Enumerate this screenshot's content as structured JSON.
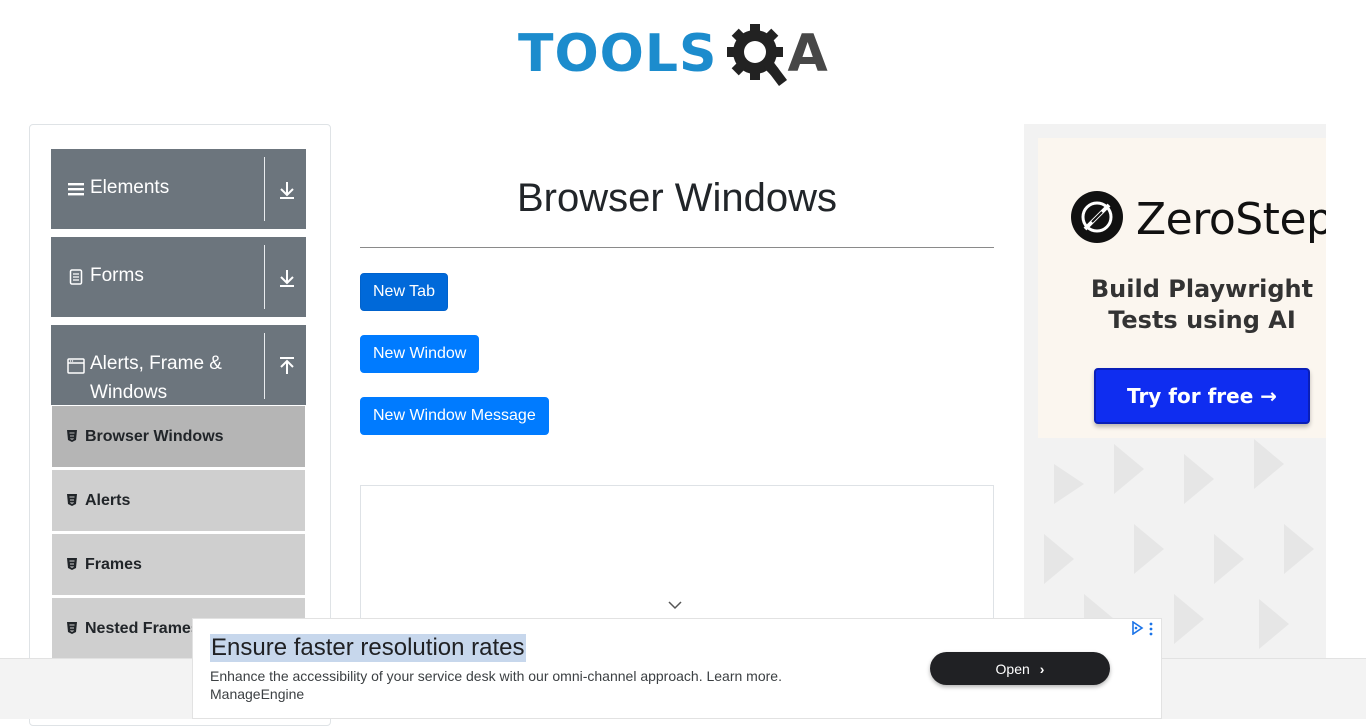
{
  "header": {
    "logo_text": "TOOLS",
    "logo_suffix": "A"
  },
  "sidebar": {
    "groups": [
      {
        "label": "Elements",
        "icon": "hamburger-icon",
        "toggle": "download-icon"
      },
      {
        "label": "Forms",
        "icon": "document-icon",
        "toggle": "download-icon"
      },
      {
        "label": "Alerts, Frame & Windows",
        "icon": "window-icon",
        "toggle": "upload-icon"
      }
    ],
    "items": [
      {
        "label": "Browser Windows",
        "active": true
      },
      {
        "label": "Alerts"
      },
      {
        "label": "Frames"
      },
      {
        "label": "Nested Frames"
      }
    ]
  },
  "main": {
    "title": "Browser Windows",
    "buttons": {
      "new_tab": "New Tab",
      "new_window": "New Window",
      "new_window_message": "New Window Message"
    }
  },
  "right_ad": {
    "brand": "ZeroStep",
    "tagline_1": "Build Playwright",
    "tagline_2": "Tests using AI",
    "cta": "Try for free →"
  },
  "bottom_ad": {
    "headline": "Ensure faster resolution rates",
    "body": "Enhance the accessibility of your service desk with our omni-channel approach. Learn more.",
    "advertiser": "ManageEngine",
    "cta": "Open"
  },
  "colors": {
    "brand_blue": "#1c8ccd",
    "button_blue": "#007bff",
    "sidebar_gray": "#6c757d",
    "zerostep_blue": "#0f2df0"
  }
}
